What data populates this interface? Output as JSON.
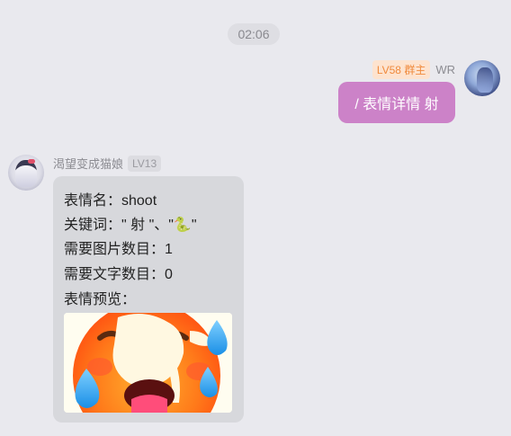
{
  "time": "02:06",
  "outgoing": {
    "level_badge": "LV58 群主",
    "sender": "WR",
    "message": "/ 表情详情 射"
  },
  "incoming": {
    "sender": "渴望变成猫娘",
    "level_badge": "LV13",
    "lines": [
      "表情名：shoot",
      "关键词：\" 射 \"、\"🐍\"",
      "需要图片数目：1",
      "需要文字数目：0",
      "表情预览："
    ],
    "preview_icon": "hot-face-emoji-icon"
  }
}
